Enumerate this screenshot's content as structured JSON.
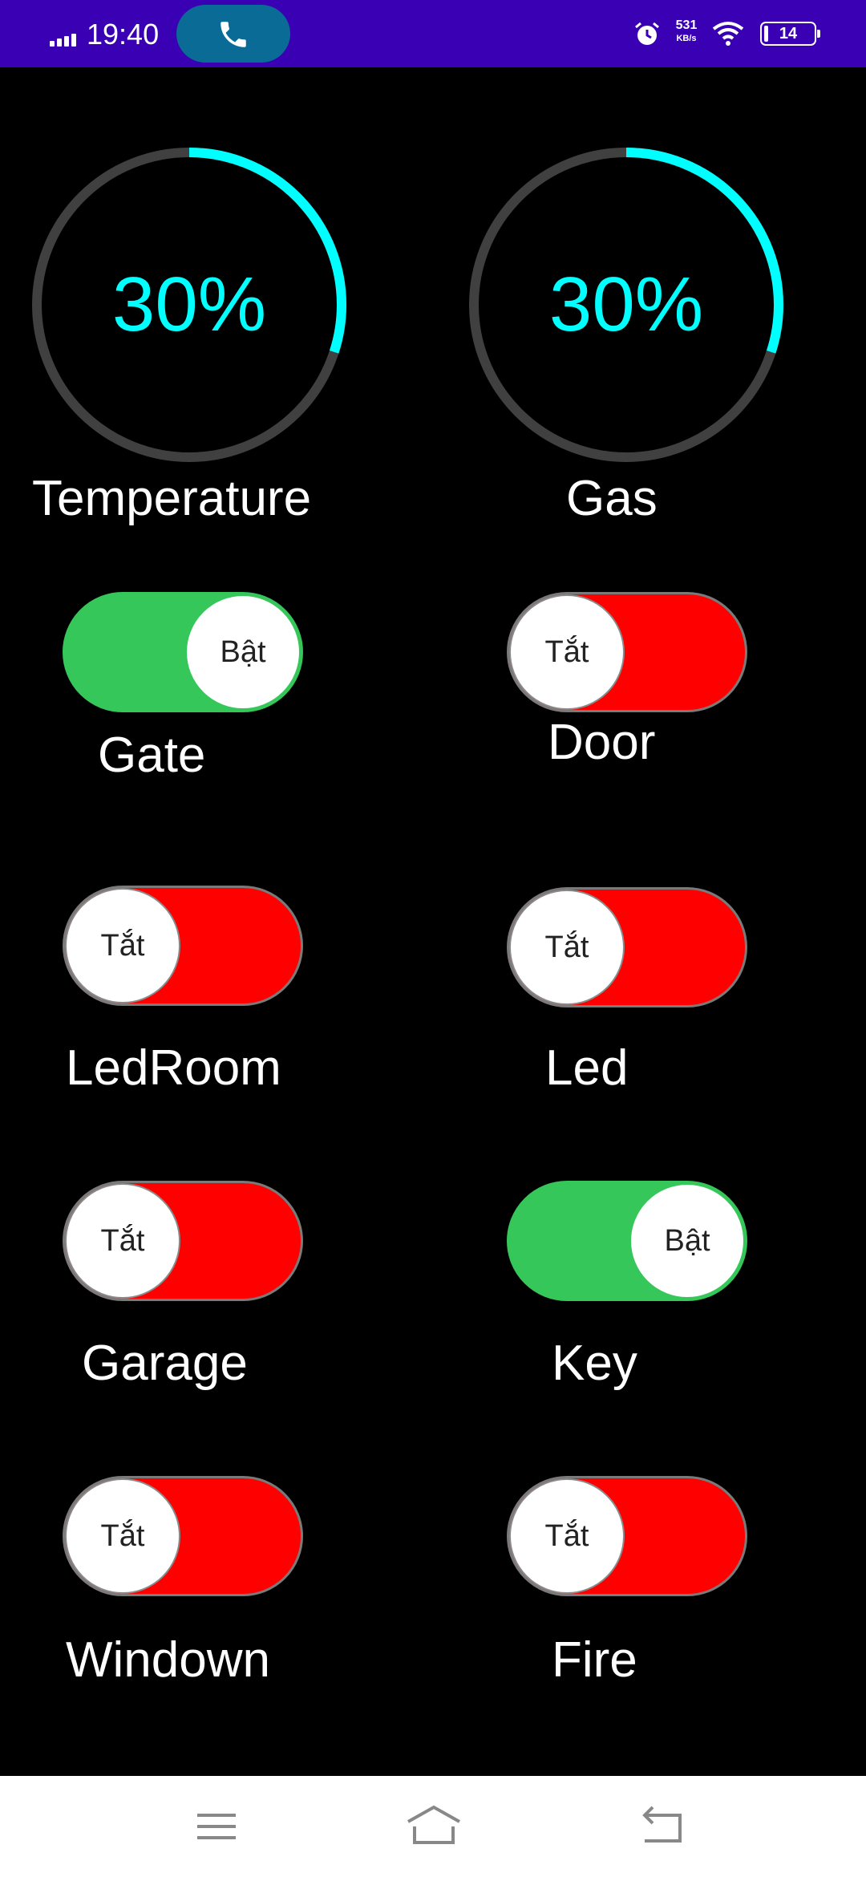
{
  "status_bar": {
    "time": "19:40",
    "net_speed_value": "531",
    "net_speed_unit": "KB/s",
    "battery_level": "14",
    "icons": [
      "signal-icon",
      "phone-icon",
      "alarm-icon",
      "wifi-icon",
      "battery-icon"
    ],
    "background_color": "#3a00b4",
    "call_pill_color": "#0a6b96"
  },
  "gauges": [
    {
      "value": "30%",
      "fraction": 0.3,
      "label": "Temperature"
    },
    {
      "value": "30%",
      "fraction": 0.3,
      "label": "Gas"
    }
  ],
  "switches": [
    {
      "label": "Gate",
      "state": "Bật",
      "on": true
    },
    {
      "label": "Door",
      "state": "Tắt",
      "on": false
    },
    {
      "label": "LedRoom",
      "state": "Tắt",
      "on": false
    },
    {
      "label": "Led",
      "state": "Tắt",
      "on": false
    },
    {
      "label": "Garage",
      "state": "Tắt",
      "on": false
    },
    {
      "label": "Key",
      "state": "Bật",
      "on": true
    },
    {
      "label": "Windown",
      "state": "Tắt",
      "on": false
    },
    {
      "label": "Fire",
      "state": "Tắt",
      "on": false
    }
  ],
  "colors": {
    "gauge_progress": "#00ffff",
    "gauge_track": "#404040",
    "switch_on": "#35c759",
    "switch_off": "#ff0000"
  },
  "nav_bar": {
    "icons": [
      "menu-icon",
      "home-icon",
      "back-icon"
    ]
  }
}
